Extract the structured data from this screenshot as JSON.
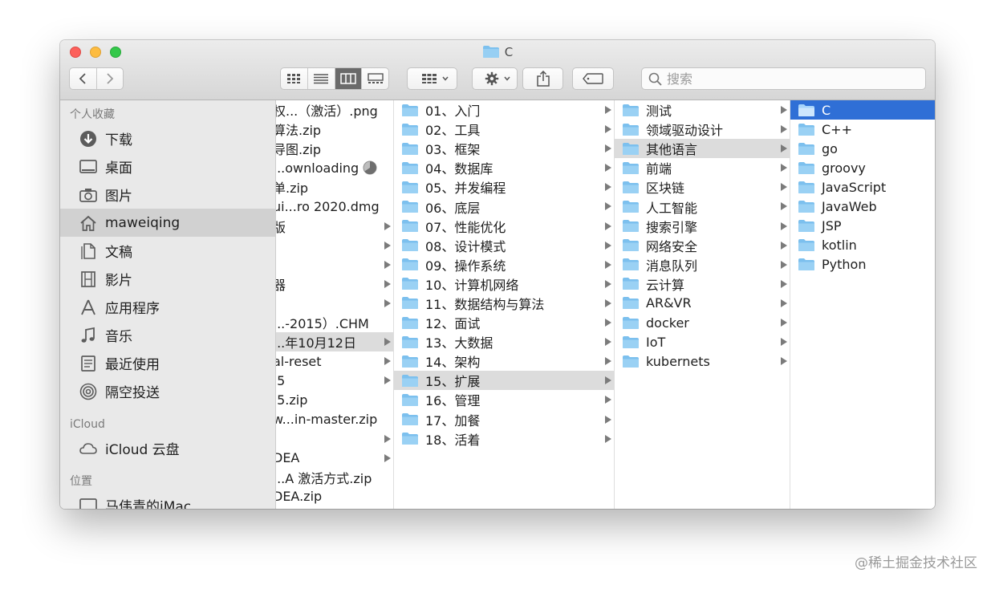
{
  "window": {
    "title": "C"
  },
  "search": {
    "placeholder": "搜索"
  },
  "sidebar": {
    "favorites_title": "个人收藏",
    "favorites": [
      {
        "label": "下载",
        "icon": "download-icon"
      },
      {
        "label": "桌面",
        "icon": "desktop-icon"
      },
      {
        "label": "图片",
        "icon": "camera-icon"
      },
      {
        "label": "maweiqing",
        "icon": "home-icon",
        "selected": true
      },
      {
        "label": "文稿",
        "icon": "document-icon"
      },
      {
        "label": "影片",
        "icon": "film-icon"
      },
      {
        "label": "应用程序",
        "icon": "applications-icon"
      },
      {
        "label": "音乐",
        "icon": "music-icon"
      },
      {
        "label": "最近使用",
        "icon": "recents-icon"
      },
      {
        "label": "隔空投送",
        "icon": "airdrop-icon"
      }
    ],
    "icloud_title": "iCloud",
    "icloud": [
      {
        "label": "iCloud 云盘",
        "icon": "cloud-icon"
      }
    ],
    "locations_title": "位置",
    "locations": [
      {
        "label": "马伟青的iMac",
        "icon": "imac-icon"
      }
    ]
  },
  "columns": {
    "col0": [
      {
        "label": "权...（激活）.png",
        "arrow": false
      },
      {
        "label": "算法.zip",
        "arrow": false
      },
      {
        "label": "导图.zip",
        "arrow": false
      },
      {
        "label": "...ownloading",
        "arrow": false,
        "downloading": true
      },
      {
        "label": "单.zip",
        "arrow": false
      },
      {
        "label": "ui...ro 2020.dmg",
        "arrow": false
      },
      {
        "label": "版",
        "arrow": true
      },
      {
        "label": "",
        "arrow": true
      },
      {
        "label": "",
        "arrow": true
      },
      {
        "label": "器",
        "arrow": true
      },
      {
        "label": "",
        "arrow": true
      },
      {
        "label": "...-2015）.CHM",
        "arrow": false
      },
      {
        "label": "...年10月12日",
        "arrow": true,
        "selected": true
      },
      {
        "label": "al-reset",
        "arrow": true
      },
      {
        "label": ".5",
        "arrow": true
      },
      {
        "label": ".5.zip",
        "arrow": false
      },
      {
        "label": "w...in-master.zip",
        "arrow": false
      },
      {
        "label": "",
        "arrow": true
      },
      {
        "label": "DEA",
        "arrow": true
      },
      {
        "label": "...A 激活方式.zip",
        "arrow": false
      },
      {
        "label": "DEA.zip",
        "arrow": false
      }
    ],
    "col1": [
      {
        "label": "01、入门"
      },
      {
        "label": "02、工具"
      },
      {
        "label": "03、框架"
      },
      {
        "label": "04、数据库"
      },
      {
        "label": "05、并发编程"
      },
      {
        "label": "06、底层"
      },
      {
        "label": "07、性能优化"
      },
      {
        "label": "08、设计模式"
      },
      {
        "label": "09、操作系统"
      },
      {
        "label": "10、计算机网络"
      },
      {
        "label": "11、数据结构与算法"
      },
      {
        "label": "12、面试"
      },
      {
        "label": "13、大数据"
      },
      {
        "label": "14、架构"
      },
      {
        "label": "15、扩展",
        "selected": true
      },
      {
        "label": "16、管理"
      },
      {
        "label": "17、加餐"
      },
      {
        "label": "18、活着"
      }
    ],
    "col2": [
      {
        "label": "测试"
      },
      {
        "label": "领域驱动设计"
      },
      {
        "label": "其他语言",
        "selected": true
      },
      {
        "label": "前端"
      },
      {
        "label": "区块链"
      },
      {
        "label": "人工智能"
      },
      {
        "label": "搜索引擎"
      },
      {
        "label": "网络安全"
      },
      {
        "label": "消息队列"
      },
      {
        "label": "云计算"
      },
      {
        "label": "AR&VR"
      },
      {
        "label": "docker"
      },
      {
        "label": "IoT"
      },
      {
        "label": "kubernets"
      }
    ],
    "col3": [
      {
        "label": "C",
        "selected": true
      },
      {
        "label": "C++"
      },
      {
        "label": "go"
      },
      {
        "label": "groovy"
      },
      {
        "label": "JavaScript"
      },
      {
        "label": "JavaWeb"
      },
      {
        "label": "JSP"
      },
      {
        "label": "kotlin"
      },
      {
        "label": "Python"
      }
    ]
  },
  "colors": {
    "folder": "#7cc0ee",
    "selection_blue": "#2f6fd6",
    "selection_gray": "#dcdcdc"
  },
  "watermark": "@稀土掘金技术社区"
}
